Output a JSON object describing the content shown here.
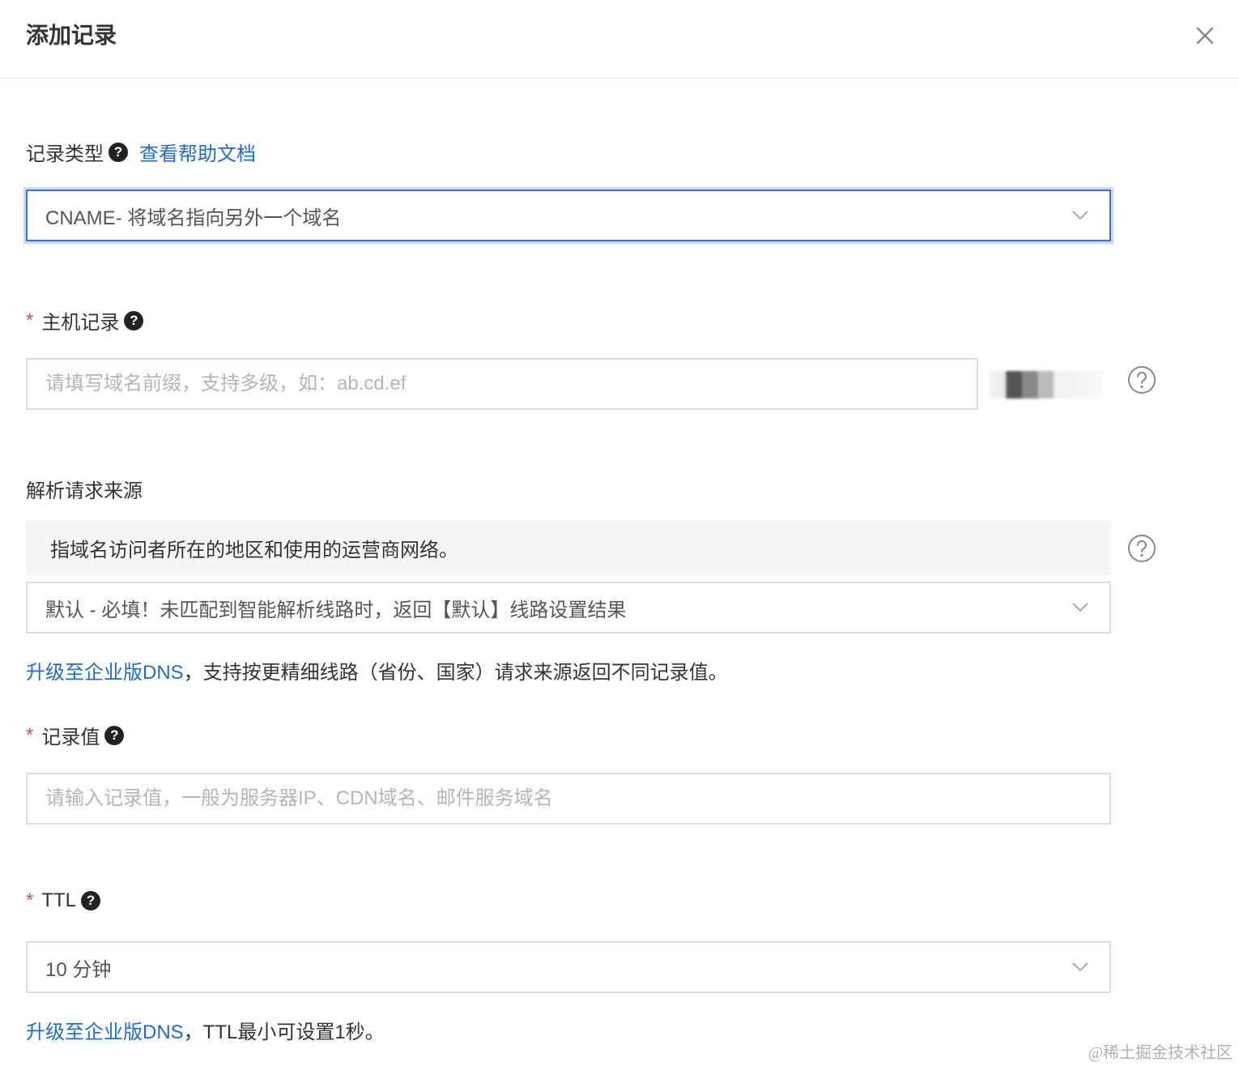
{
  "dialog": {
    "title": "添加记录"
  },
  "record_type": {
    "label": "记录类型",
    "help_link": "查看帮助文档",
    "selected": "CNAME- 将域名指向另外一个域名"
  },
  "host_record": {
    "required_mark": "*",
    "label": "主机记录",
    "placeholder": "请填写域名前缀，支持多级，如：ab.cd.ef"
  },
  "resolution_source": {
    "label": "解析请求来源",
    "tip": "指域名访问者所在的地区和使用的运营商网络。",
    "selected": "默认 - 必填！未匹配到智能解析线路时，返回【默认】线路设置结果",
    "upgrade_link": "升级至企业版DNS",
    "upgrade_note": "，支持按更精细线路（省份、国家）请求来源返回不同记录值。"
  },
  "record_value": {
    "required_mark": "*",
    "label": "记录值",
    "placeholder": "请输入记录值，一般为服务器IP、CDN域名、邮件服务域名"
  },
  "ttl": {
    "required_mark": "*",
    "label": "TTL",
    "selected": "10 分钟",
    "upgrade_link": "升级至企业版DNS",
    "upgrade_note": "，TTL最小可设置1秒。"
  },
  "icons": {
    "close": "close-icon",
    "question": "question-icon",
    "help_circle": "help-circle-icon",
    "chevron": "chevron-down-icon"
  },
  "colors": {
    "link": "#1e6ccf",
    "required": "#d9534f",
    "focus_border": "#3a6fd8"
  },
  "watermark": "@稀土掘金技术社区"
}
